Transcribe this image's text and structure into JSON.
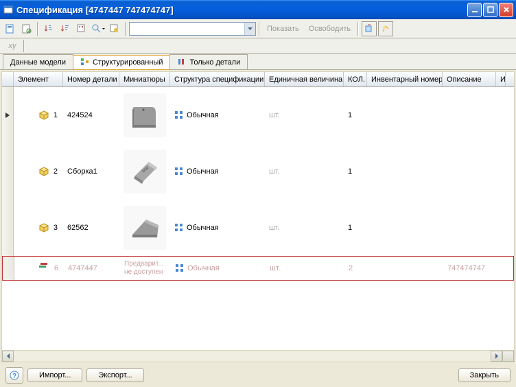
{
  "title": "Спецификация [4747447 747474747]",
  "toolbar": {
    "show": "Показать",
    "release": "Освободить"
  },
  "formula": {
    "fx": "xy"
  },
  "tabs": {
    "model": "Данные модели",
    "structured": "Структурированный",
    "parts_only": "Только детали"
  },
  "columns": {
    "element": "Элемент",
    "part_number": "Номер детали",
    "thumbnail": "Миниатюры",
    "structure": "Структура спецификации",
    "unit": "Единичная величина",
    "qty": "КОЛ.",
    "inventory": "Инвентарный номер:",
    "desc": "Описание",
    "last": "И"
  },
  "rows": [
    {
      "num": "1",
      "part": "424524",
      "structure": "Обычная",
      "unit": "шт.",
      "qty": "1",
      "inv": "",
      "desc": "",
      "thumb": "box"
    },
    {
      "num": "2",
      "part": "Сборка1",
      "structure": "Обычная",
      "unit": "шт.",
      "qty": "1",
      "inv": "",
      "desc": "",
      "thumb": "slab"
    },
    {
      "num": "3",
      "part": "62562",
      "structure": "Обычная",
      "unit": "шт.",
      "qty": "1",
      "inv": "",
      "desc": "",
      "thumb": "wedge"
    },
    {
      "num": "6",
      "part": "4747447",
      "structure": "Обычная",
      "unit": "шт.",
      "qty": "2",
      "inv": "",
      "desc": "747474747",
      "thumb": "none",
      "thumb_text": "Предварит... не доступен",
      "highlight": true
    }
  ],
  "buttons": {
    "import": "Импорт...",
    "export": "Экспорт...",
    "close": "Закрыть"
  }
}
